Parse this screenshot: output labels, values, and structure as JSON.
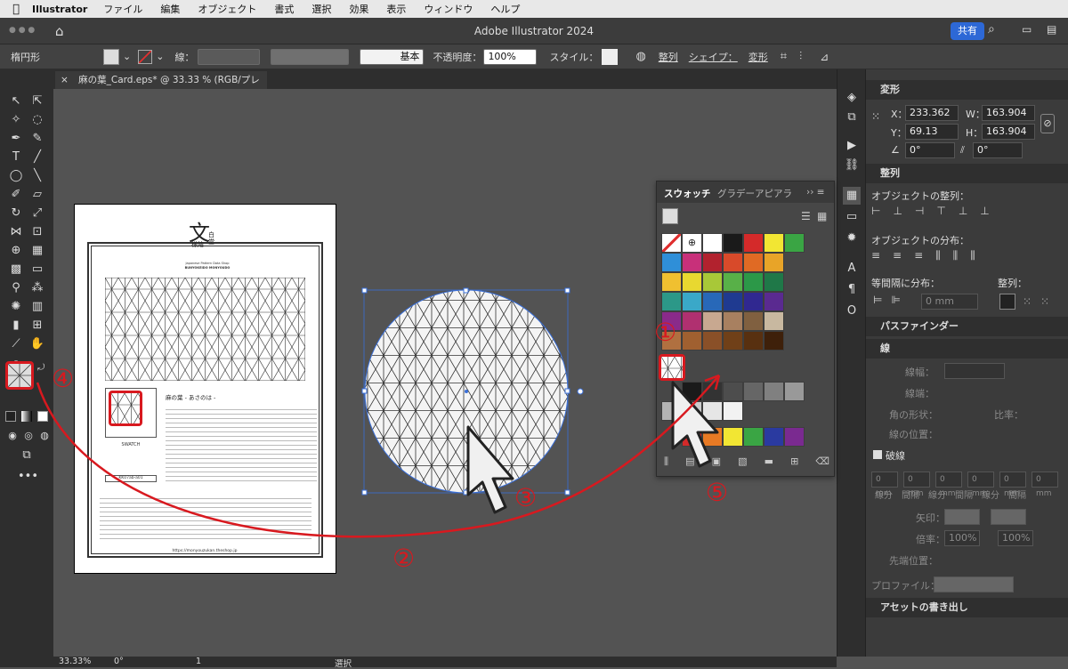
{
  "menubar": {
    "app": "Illustrator",
    "menus": [
      "ファイル",
      "編集",
      "オブジェクト",
      "書式",
      "選択",
      "効果",
      "表示",
      "ウィンドウ",
      "ヘルプ"
    ]
  },
  "titlebar": {
    "title": "Adobe Illustrator 2024",
    "share_label": "共有"
  },
  "control_bar": {
    "object_type": "楕円形",
    "stroke_label": "線：",
    "stroke_style": "基本",
    "opacity_label": "不透明度：",
    "opacity_value": "100%",
    "style_label": "スタイル：",
    "align_label": "整列",
    "shape_label": "シェイプ：",
    "transform_label": "変形"
  },
  "document_tab": {
    "label": "麻の葉_Card.eps* @ 33.33 % (RGB/プレビュー)",
    "close": "×"
  },
  "artboard": {
    "logo_char": "文",
    "logo_sub1": "様結",
    "logo_sub2": "白堂",
    "brand_line1": "Japanese Pattern Data Shop",
    "brand_line2": "BUNYOKEIDO MONYOUDO",
    "pattern_title": "麻の葉 - あさのは -",
    "swatch_caption": "SWATCH",
    "code": "KK07ab-a01",
    "url": "https://monyouzukan.theshop.jp"
  },
  "swatch_panel": {
    "tabs": [
      "スウォッチ",
      "グラデー",
      "アピアラ"
    ],
    "colors_row1": [
      "#ffffff",
      "#1a1a1a",
      "#d42a2a",
      "#f2e633",
      "#3aa544"
    ],
    "colors_row2": [
      "#2f8fd8",
      "#c8307a",
      "#b2222e",
      "#d84a2a",
      "#e06a24",
      "#e8a428"
    ],
    "colors_row3": [
      "#f0c030",
      "#e8d830",
      "#a8c838",
      "#58b048",
      "#2c9848",
      "#1f7848"
    ],
    "colors_row4": [
      "#2c9888",
      "#3aa8c8",
      "#2868b8",
      "#1f3a90",
      "#302890",
      "#5a2a90"
    ],
    "colors_row5": [
      "#8a2a8a",
      "#b03070",
      "#c8a890",
      "#a88060",
      "#806040",
      "#c8b8a0"
    ],
    "colors_row6": [
      "#b07040",
      "#a06030",
      "#8a5028",
      "#704018",
      "#583010",
      "#3e200a"
    ],
    "gray_row": [
      "#1a1a1a",
      "#333333",
      "#4d4d4d",
      "#666666",
      "#808080",
      "#999999"
    ],
    "gray_row2": [
      "#b3b3b3",
      "#cccccc",
      "#e6e6e6",
      "#f2f2f2"
    ],
    "bright_row": [
      "#d42a2a",
      "#e87a24",
      "#f2e633",
      "#3aa544",
      "#2a3aa0",
      "#7a2a90"
    ]
  },
  "right_panel": {
    "transform": {
      "title": "変形",
      "x_label": "X：",
      "x_value": "233.362 m",
      "w_label": "W：",
      "w_value": "163.904 m",
      "y_label": "Y：",
      "y_value": "69.13 mm",
      "h_label": "H：",
      "h_value": "163.904 m",
      "angle_value": "0°",
      "shear_value": "0°"
    },
    "align": {
      "title": "整列",
      "objects_label": "オブジェクトの整列：",
      "distribute_label": "オブジェクトの分布：",
      "spacing_label": "等間隔に分布：",
      "align_to_label": "整列：",
      "spacing_value": "0 mm"
    },
    "pathfinder": {
      "title": "パスファインダー"
    },
    "stroke": {
      "title": "線",
      "weight_label": "線幅：",
      "cap_label": "線端：",
      "corner_label": "角の形状：",
      "limit_label": "比率：",
      "position_label": "線の位置：",
      "dashed_label": "破線",
      "dash_labels": [
        "線分",
        "間隔",
        "線分",
        "間隔",
        "線分",
        "間隔"
      ],
      "dash_value": "0 mm",
      "arrow_label": "矢印：",
      "scale_label": "倍率：",
      "scale_value": "100%",
      "tip_label": "先端位置：",
      "profile_label": "プロファイル："
    },
    "export": {
      "title": "アセットの書き出し"
    }
  },
  "status_bar": {
    "zoom": "33.33%",
    "rotation": "0°",
    "artboard_num": "1",
    "mode": "選択"
  },
  "callouts": [
    "①",
    "②",
    "③",
    "④",
    "⑤"
  ],
  "colors": {
    "callout_red": "#d8191f",
    "selection_blue": "#3a6fd8",
    "share_blue": "#2d68d6"
  }
}
